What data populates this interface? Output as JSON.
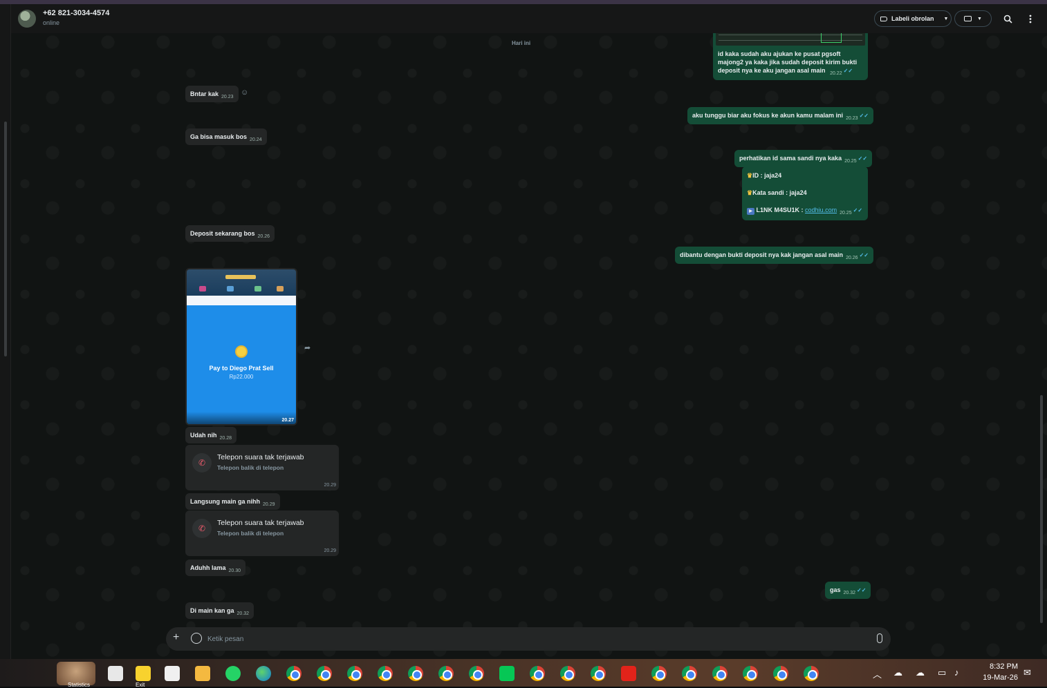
{
  "header": {
    "contact_name": "+62 821-3034-4574",
    "status": "online",
    "label_button": "Labeli obrolan",
    "icons": [
      "label-icon",
      "video-call-icon",
      "search-icon",
      "menu-icon"
    ]
  },
  "day_chip": "Hari ini",
  "top_out_message": {
    "text": "id kaka sudah aku ajukan ke pusat pgsoft majong2 ya kaka jika sudah deposit kirim bukti deposit nya ke aku jangan asal main",
    "time": "20.22"
  },
  "messages": [
    {
      "dir": "in",
      "text": "Bntar kak",
      "time": "20.23"
    },
    {
      "dir": "out",
      "text": "aku tunggu biar aku fokus ke akun kamu malam ini",
      "time": "20.23"
    },
    {
      "dir": "in",
      "text": "Ga bisa masuk bos",
      "time": "20.24"
    },
    {
      "dir": "out",
      "text": "perhatikan id sama sandi nya kaka",
      "time": "20.25"
    },
    {
      "dir": "in",
      "text": "Deposit sekarang bos",
      "time": "20.26"
    },
    {
      "dir": "out",
      "text": "dibantu dengan bukti deposit nya kak jangan asal main",
      "time": "20.26"
    },
    {
      "dir": "in",
      "text": "Udah nih",
      "time": "20.28"
    },
    {
      "dir": "in",
      "text": "Langsung main ga nihh",
      "time": "20.29"
    },
    {
      "dir": "in",
      "text": "Aduhh lama",
      "time": "20.30"
    },
    {
      "dir": "out",
      "text": "gas",
      "time": "20.32"
    },
    {
      "dir": "in",
      "text": "Di main kan ga",
      "time": "20.32"
    }
  ],
  "credentials": {
    "id_line": "ID :  jaja24",
    "pass_line": "Kata sandi : jaja24",
    "link_label": "L1NK M4SU1K :",
    "link_text": "codhiu.com",
    "time": "20.25"
  },
  "image_message": {
    "pay_to": "Pay to Diego Prat Sell",
    "amount": "Rp22.000",
    "time": "20.27"
  },
  "calls": [
    {
      "title": "Telepon suara tak terjawab",
      "subtitle": "Telepon balik di telepon",
      "time": "20.29"
    },
    {
      "title": "Telepon suara tak terjawab",
      "subtitle": "Telepon balik di telepon",
      "time": "20.29"
    }
  ],
  "composer": {
    "placeholder": "Ketik pesan"
  },
  "taskbar": {
    "widget_label": "Statistics",
    "exit_label": "Exit",
    "time": "8:32 PM",
    "date": "19-Mar-26"
  },
  "colors": {
    "incoming": "#242626",
    "outgoing": "#144d37",
    "accent": "#53bdeb",
    "missed_call": "#f15c6d"
  }
}
